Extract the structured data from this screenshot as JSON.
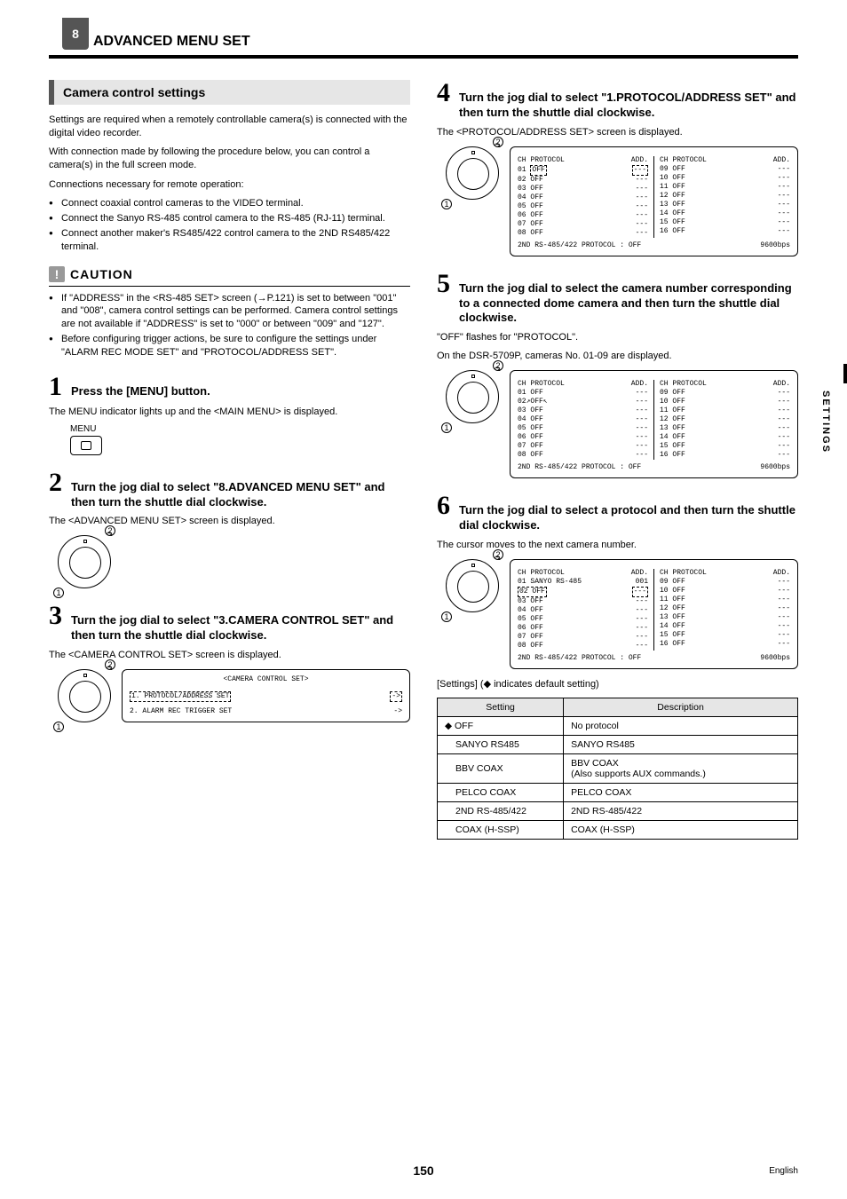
{
  "chapter_num": "8",
  "chapter_title": "ADVANCED MENU SET",
  "section_title": "Camera control settings",
  "intro1": "Settings are required when a remotely controllable camera(s) is connected with the digital video recorder.",
  "intro2": "With connection made by following the procedure below, you can control a camera(s) in the full screen mode.",
  "conn_title": "Connections necessary for remote operation:",
  "conn": [
    "Connect coaxial control cameras to the VIDEO terminal.",
    "Connect the Sanyo RS-485 control camera to the RS-485 (RJ-11) terminal.",
    "Connect another maker's RS485/422 control camera to the 2ND RS485/422 terminal."
  ],
  "caution_label": "CAUTION",
  "caution": [
    "If \"ADDRESS\" in the <RS-485 SET> screen (→P.121) is set to between \"001\" and \"008\", camera control settings can be performed. Camera control settings are not available if \"ADDRESS\" is set to \"000\" or between \"009\" and \"127\".",
    "Before configuring trigger actions, be sure to configure the settings under \"ALARM REC MODE SET\" and \"PROTOCOL/ADDRESS SET\"."
  ],
  "steps": {
    "s1": {
      "title": "Press the [MENU] button.",
      "body": "The MENU indicator lights up and the <MAIN MENU> is displayed.",
      "menu_label": "MENU"
    },
    "s2": {
      "title": "Turn the jog dial to select \"8.ADVANCED MENU SET\" and then turn the shuttle dial clockwise.",
      "body": "The <ADVANCED MENU SET> screen is displayed."
    },
    "s3": {
      "title": "Turn the jog dial to select \"3.CAMERA CONTROL SET\" and then turn the shuttle dial clockwise.",
      "body": "The <CAMERA CONTROL SET> screen is displayed."
    },
    "s4": {
      "title": "Turn the jog dial to select \"1.PROTOCOL/ADDRESS SET\" and then turn the shuttle dial clockwise.",
      "body": "The <PROTOCOL/ADDRESS SET> screen is displayed."
    },
    "s5": {
      "title": "Turn the jog dial to select the camera number corresponding to a connected dome camera and then turn the shuttle dial clockwise.",
      "body1": "\"OFF\" flashes for \"PROTOCOL\".",
      "body2": "On the DSR-5709P, cameras No. 01-09 are displayed."
    },
    "s6": {
      "title": "Turn the jog dial to select a protocol and then turn the shuttle dial clockwise.",
      "body": "The cursor moves to the next camera number."
    }
  },
  "screen3": {
    "title": "<CAMERA CONTROL SET>",
    "items": [
      "1. PROTOCOL/ADDRESS SET",
      "2. ALARM REC TRIGGER SET"
    ],
    "arrow": "->"
  },
  "protocol_screen_title": "<PROTOCOL/ADDRESS SET>",
  "protocol_headers": {
    "ch": "CH",
    "proto": "PROTOCOL",
    "add": "ADD."
  },
  "screen4_left": [
    {
      "ch": "01",
      "proto": "OFF",
      "add": "---"
    },
    {
      "ch": "02",
      "proto": "OFF",
      "add": "---"
    },
    {
      "ch": "03",
      "proto": "OFF",
      "add": "---"
    },
    {
      "ch": "04",
      "proto": "OFF",
      "add": "---"
    },
    {
      "ch": "05",
      "proto": "OFF",
      "add": "---"
    },
    {
      "ch": "06",
      "proto": "OFF",
      "add": "---"
    },
    {
      "ch": "07",
      "proto": "OFF",
      "add": "---"
    },
    {
      "ch": "08",
      "proto": "OFF",
      "add": "---"
    }
  ],
  "screen4_right": [
    {
      "ch": "09",
      "proto": "OFF",
      "add": "---"
    },
    {
      "ch": "10",
      "proto": "OFF",
      "add": "---"
    },
    {
      "ch": "11",
      "proto": "OFF",
      "add": "---"
    },
    {
      "ch": "12",
      "proto": "OFF",
      "add": "---"
    },
    {
      "ch": "13",
      "proto": "OFF",
      "add": "---"
    },
    {
      "ch": "14",
      "proto": "OFF",
      "add": "---"
    },
    {
      "ch": "15",
      "proto": "OFF",
      "add": "---"
    },
    {
      "ch": "16",
      "proto": "OFF",
      "add": "---"
    }
  ],
  "screen6_left": [
    {
      "ch": "01",
      "proto": "SANYO RS-485",
      "add": "001"
    },
    {
      "ch": "02",
      "proto": "OFF",
      "add": "---"
    },
    {
      "ch": "03",
      "proto": "OFF",
      "add": "---"
    },
    {
      "ch": "04",
      "proto": "OFF",
      "add": "---"
    },
    {
      "ch": "05",
      "proto": "OFF",
      "add": "---"
    },
    {
      "ch": "06",
      "proto": "OFF",
      "add": "---"
    },
    {
      "ch": "07",
      "proto": "OFF",
      "add": "---"
    },
    {
      "ch": "08",
      "proto": "OFF",
      "add": "---"
    }
  ],
  "screen_footer_label": "2ND RS-485/422 PROTOCOL",
  "screen_footer_val": ": OFF",
  "screen_footer_bps": "9600bps",
  "settings_note": "[Settings] (◆ indicates default setting)",
  "settings_table": {
    "head_setting": "Setting",
    "head_desc": "Description",
    "rows": [
      {
        "s": "◆ OFF",
        "d": "No protocol",
        "pad": false
      },
      {
        "s": "SANYO RS485",
        "d": "SANYO RS485",
        "pad": true
      },
      {
        "s": "BBV COAX",
        "d": "BBV COAX\n(Also supports AUX commands.)",
        "pad": true
      },
      {
        "s": "PELCO COAX",
        "d": "PELCO COAX",
        "pad": true
      },
      {
        "s": "2ND RS-485/422",
        "d": "2ND RS-485/422",
        "pad": true
      },
      {
        "s": "COAX (H-SSP)",
        "d": "COAX (H-SSP)",
        "pad": true
      }
    ]
  },
  "side_label": "SETTINGS",
  "page_number": "150",
  "footer_lang": "English",
  "dial_labels": {
    "top": "2",
    "bottom": "1"
  }
}
